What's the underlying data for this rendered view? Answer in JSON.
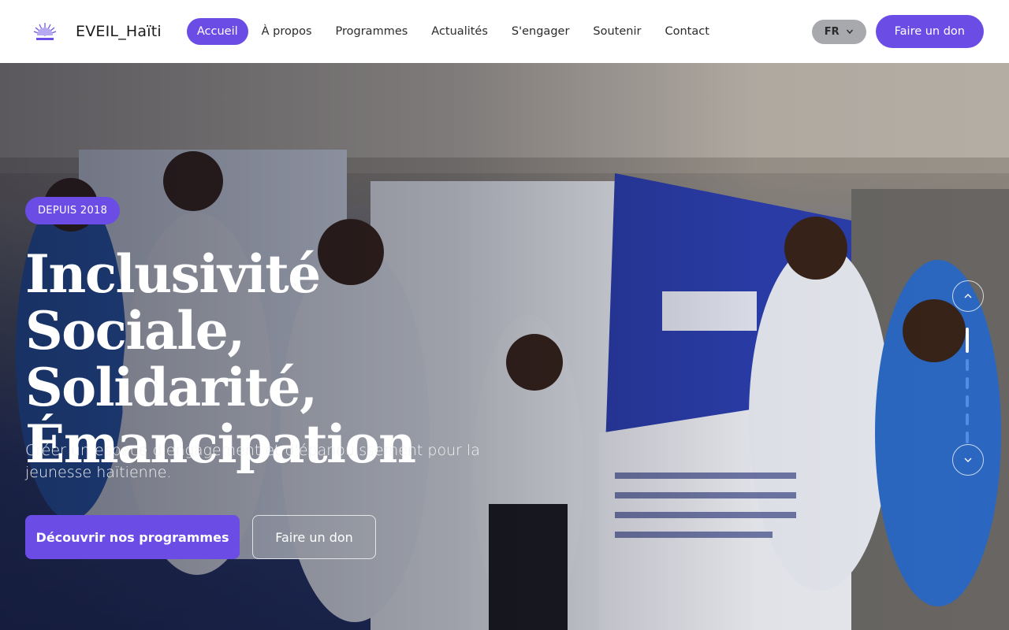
{
  "brand": {
    "name": "EVEIL_Haïti",
    "logo_icon": "sunrise-logo-icon"
  },
  "nav": {
    "items": [
      {
        "label": "Accueil",
        "active": true
      },
      {
        "label": "À propos",
        "active": false
      },
      {
        "label": "Programmes",
        "active": false
      },
      {
        "label": "Actualités",
        "active": false
      },
      {
        "label": "S'engager",
        "active": false
      },
      {
        "label": "Soutenir",
        "active": false
      },
      {
        "label": "Contact",
        "active": false
      }
    ]
  },
  "header": {
    "language": "FR",
    "donate_label": "Faire un don"
  },
  "hero": {
    "badge": "DEPUIS 2018",
    "title_lines": [
      "Inclusivité Sociale,",
      "Solidarité,",
      "Émancipation"
    ],
    "subtitle": "Créer un espace d'engagement et d'épanouissement pour la jeunesse haïtienne.",
    "primary_cta": "Découvrir nos programmes",
    "secondary_cta": "Faire un don",
    "slider": {
      "slide_count": 6,
      "active_index": 0
    }
  },
  "colors": {
    "accent": "#6b4de6",
    "language_pill": "#a7a9ad",
    "white": "#ffffff"
  }
}
